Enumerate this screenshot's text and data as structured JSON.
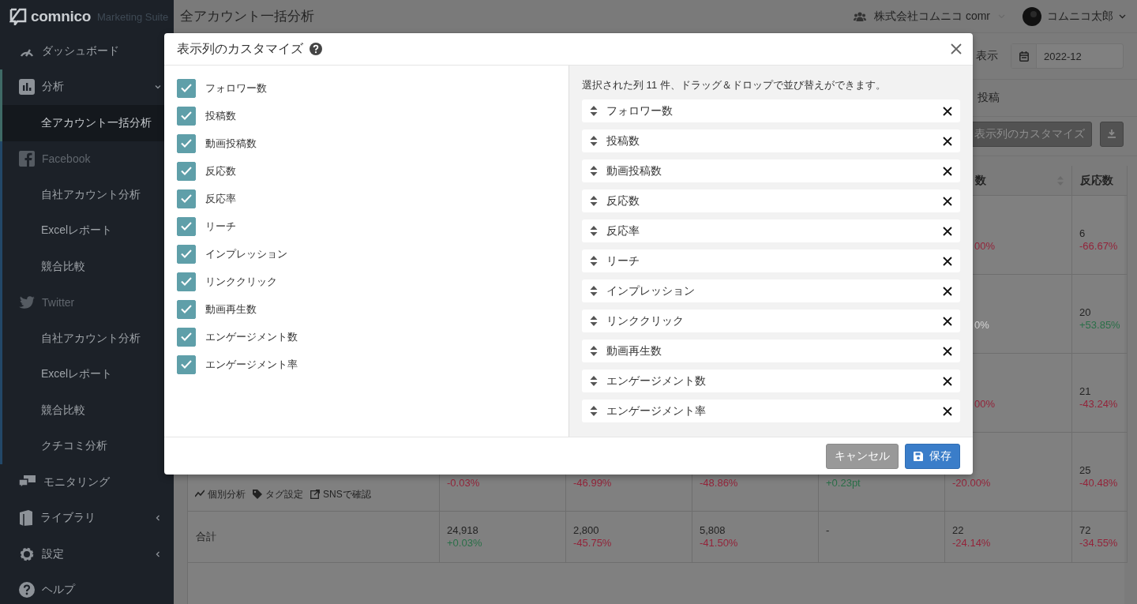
{
  "brand": {
    "name": "comnico",
    "suffix": "Marketing Suite"
  },
  "sidebar": {
    "items": [
      {
        "label": "ダッシュボード",
        "kind": "item",
        "selected": false
      },
      {
        "label": "分析",
        "kind": "item",
        "selected": false,
        "expanded": true
      },
      {
        "label": "全アカウント一括分析",
        "kind": "sub",
        "selected": true
      },
      {
        "label": "Facebook",
        "kind": "group",
        "selected": false
      },
      {
        "label": "自社アカウント分析",
        "kind": "sub",
        "selected": false
      },
      {
        "label": "Excelレポート",
        "kind": "sub",
        "selected": false
      },
      {
        "label": "競合比較",
        "kind": "sub",
        "selected": false
      },
      {
        "label": "Twitter",
        "kind": "group",
        "selected": false
      },
      {
        "label": "自社アカウント分析",
        "kind": "sub",
        "selected": false
      },
      {
        "label": "Excelレポート",
        "kind": "sub",
        "selected": false
      },
      {
        "label": "競合比較",
        "kind": "sub",
        "selected": false
      },
      {
        "label": "クチコミ分析",
        "kind": "sub",
        "selected": false
      },
      {
        "label": "モニタリング",
        "kind": "item",
        "selected": false
      },
      {
        "label": "ライブラリ",
        "kind": "item",
        "selected": false,
        "expanded": false
      },
      {
        "label": "設定",
        "kind": "item",
        "selected": false,
        "expanded": false
      },
      {
        "label": "ヘルプ",
        "kind": "item",
        "selected": false
      }
    ]
  },
  "header": {
    "title": "全アカウント一括分析",
    "account": "株式会社コムニコ comr",
    "user": "コムニコ太郎"
  },
  "filters": {
    "label": "表示",
    "month": "2022-12"
  },
  "tab_label": "投稿",
  "toolbar": {
    "customize_button": "表示列のカスタマイズ"
  },
  "table": {
    "columns": [
      {},
      {},
      {},
      {},
      {},
      {
        "label": "数",
        "sortable": true
      },
      {
        "label": "反応数"
      }
    ],
    "rows": [
      {
        "cells": [
          {},
          {},
          {},
          {},
          {},
          {
            "change": "00%",
            "color": "#93243a"
          },
          {
            "value": "6",
            "change": "-66.67%",
            "color": "#93243a"
          }
        ]
      },
      {
        "cells": [
          {},
          {},
          {},
          {},
          {},
          {
            "change": "0%",
            "color": "#d4d4d4"
          },
          {
            "value": "20",
            "change": "+53.85%",
            "color": "#2a6f48"
          }
        ]
      },
      {
        "cells": [
          {},
          {},
          {},
          {},
          {},
          {
            "change": "00%",
            "color": "#93243a"
          },
          {
            "value": "21",
            "change": "-43.24%",
            "color": "#93243a"
          }
        ]
      },
      {
        "cells": [
          {
            "links": [
              "個別分析",
              "タグ設定",
              "SNSで確認"
            ]
          },
          {
            "change": "-0.03%",
            "color": "#93243a"
          },
          {
            "change": "-46.99%",
            "color": "#93243a"
          },
          {
            "change": "-48.86%",
            "color": "#93243a"
          },
          {
            "change": "+0.23pt",
            "color": "#2a6f48"
          },
          {
            "change": "-20.00%",
            "color": "#93243a"
          },
          {
            "value": "25",
            "change": "-40.48%",
            "color": "#93243a"
          }
        ]
      },
      {
        "cells": [
          {
            "value": "合計"
          },
          {
            "value": "24,918",
            "change": "+0.03%",
            "color": "#2a6f48"
          },
          {
            "value": "2,800",
            "change": "-45.75%",
            "color": "#93243a"
          },
          {
            "value": "5,808",
            "change": "-41.50%",
            "color": "#93243a"
          },
          {
            "value": "-"
          },
          {
            "value": "22",
            "change": "-24.14%",
            "color": "#93243a"
          },
          {
            "value": "72",
            "change": "-34.55%",
            "color": "#93243a"
          }
        ]
      }
    ]
  },
  "modal": {
    "title": "表示列のカスタマイズ",
    "options": [
      {
        "label": "フォロワー数",
        "checked": true
      },
      {
        "label": "投稿数",
        "checked": true
      },
      {
        "label": "動画投稿数",
        "checked": true
      },
      {
        "label": "反応数",
        "checked": true
      },
      {
        "label": "反応率",
        "checked": true
      },
      {
        "label": "リーチ",
        "checked": true
      },
      {
        "label": "インプレッション",
        "checked": true
      },
      {
        "label": "リンククリック",
        "checked": true
      },
      {
        "label": "動画再生数",
        "checked": true
      },
      {
        "label": "エンゲージメント数",
        "checked": true
      },
      {
        "label": "エンゲージメント率",
        "checked": true
      }
    ],
    "summary": "選択された列 11 件、ドラッグ＆ドロップで並び替えができます。",
    "selected_columns": [
      "フォロワー数",
      "投稿数",
      "動画投稿数",
      "反応数",
      "反応率",
      "リーチ",
      "インプレッション",
      "リンククリック",
      "動画再生数",
      "エンゲージメント数",
      "エンゲージメント率"
    ],
    "buttons": [
      {
        "label": "キャンセル",
        "kind": "cancel"
      },
      {
        "label": "保存",
        "kind": "save"
      }
    ]
  }
}
